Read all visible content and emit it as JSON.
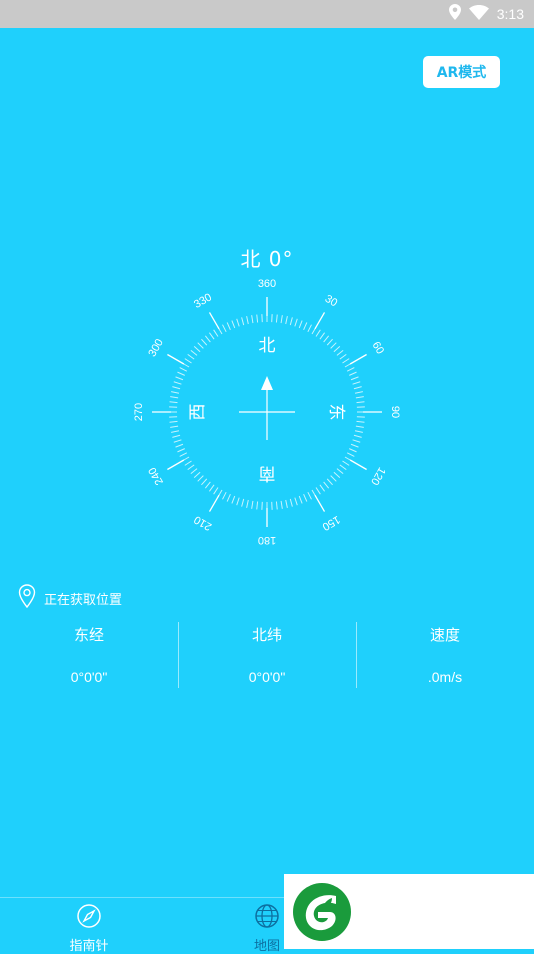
{
  "status_bar": {
    "time": "3:13",
    "icons": [
      "location-icon",
      "wifi-icon"
    ]
  },
  "ar_button_label": "AR模式",
  "compass": {
    "heading_text": "北 0°",
    "cardinals": {
      "north": "北",
      "east": "东",
      "south": "南",
      "west": "西"
    },
    "degree_labels": [
      "360",
      "30",
      "60",
      "90",
      "120",
      "150",
      "180",
      "210",
      "240",
      "270",
      "300",
      "330"
    ]
  },
  "location": {
    "status_text": "正在获取位置"
  },
  "stats": [
    {
      "label": "东经",
      "value": "0°0'0\""
    },
    {
      "label": "北纬",
      "value": "0°0'0\""
    },
    {
      "label": "速度",
      "value": ".0m/s"
    }
  ],
  "tabs": [
    {
      "label": "指南针",
      "icon": "compass-icon"
    },
    {
      "label": "地图",
      "icon": "globe-icon"
    }
  ],
  "colors": {
    "background": "#1fd0fc",
    "accent": "#1fb8ee",
    "logo_green": "#1a9b3c"
  }
}
